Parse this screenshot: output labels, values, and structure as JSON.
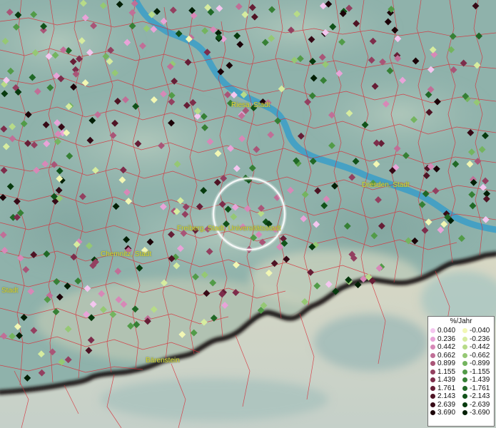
{
  "cities": [
    {
      "name": "Riesa, Stadt"
    },
    {
      "name": "Dresden, Stadt"
    },
    {
      "name": "Freiberg, Stadt, Universitätsstadt"
    },
    {
      "name": "Chemnitz, Stadt"
    },
    {
      "name": "Stadt"
    },
    {
      "name": "Bärenstein"
    }
  ],
  "legend": {
    "unit": "%/Jahr",
    "positive": [
      {
        "label": "0.040",
        "color": "#f4c6ef"
      },
      {
        "label": "0.236",
        "color": "#e8a3d8"
      },
      {
        "label": "0.442",
        "color": "#d788b7"
      },
      {
        "label": "0.662",
        "color": "#c06f97"
      },
      {
        "label": "0.899",
        "color": "#a95577"
      },
      {
        "label": "1.155",
        "color": "#934060"
      },
      {
        "label": "1.439",
        "color": "#7d2d4b"
      },
      {
        "label": "1.761",
        "color": "#661e36"
      },
      {
        "label": "2.143",
        "color": "#4e1424"
      },
      {
        "label": "2.639",
        "color": "#360a16"
      },
      {
        "label": "3.690",
        "color": "#1c0308"
      }
    ],
    "negative": [
      {
        "label": "-0.040",
        "color": "#f2f7b4"
      },
      {
        "label": "-0.236",
        "color": "#d6ec9f"
      },
      {
        "label": "-0.442",
        "color": "#b7db88"
      },
      {
        "label": "-0.662",
        "color": "#95c874"
      },
      {
        "label": "-0.899",
        "color": "#74b45f"
      },
      {
        "label": "-1.155",
        "color": "#529b48"
      },
      {
        "label": "-1.439",
        "color": "#368035"
      },
      {
        "label": "-1.761",
        "color": "#206826"
      },
      {
        "label": "-2.143",
        "color": "#115219"
      },
      {
        "label": "-2.639",
        "color": "#073a0e"
      },
      {
        "label": "-3.690",
        "color": "#021f05"
      }
    ]
  },
  "colors": {
    "river": "#3a9ec8",
    "boundary": "#d8303a",
    "terrain": "#8fb2ab",
    "highlight_ring": "#ffffff"
  }
}
